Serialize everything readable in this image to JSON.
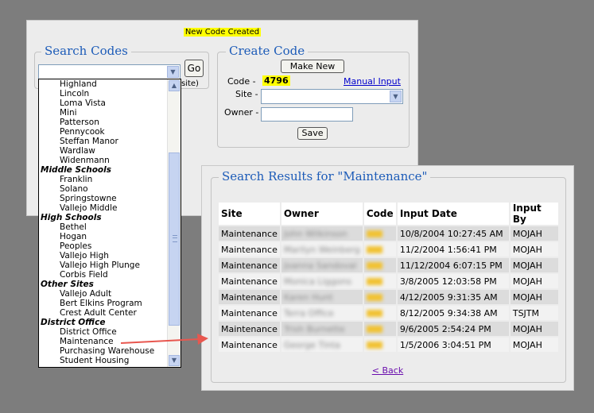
{
  "banner": {
    "message": "New Code Created"
  },
  "search_codes": {
    "legend": "Search Codes",
    "go_label": "Go",
    "hint_tail": "site)",
    "dropdown_items": [
      {
        "label": "Highland",
        "group": false
      },
      {
        "label": "Lincoln",
        "group": false
      },
      {
        "label": "Loma Vista",
        "group": false
      },
      {
        "label": "Mini",
        "group": false
      },
      {
        "label": "Patterson",
        "group": false
      },
      {
        "label": "Pennycook",
        "group": false
      },
      {
        "label": "Steffan Manor",
        "group": false
      },
      {
        "label": "Wardlaw",
        "group": false
      },
      {
        "label": "Widenmann",
        "group": false
      },
      {
        "label": "Middle Schools",
        "group": true
      },
      {
        "label": "Franklin",
        "group": false
      },
      {
        "label": "Solano",
        "group": false
      },
      {
        "label": "Springstowne",
        "group": false
      },
      {
        "label": "Vallejo Middle",
        "group": false
      },
      {
        "label": "High Schools",
        "group": true
      },
      {
        "label": "Bethel",
        "group": false
      },
      {
        "label": "Hogan",
        "group": false
      },
      {
        "label": "Peoples",
        "group": false
      },
      {
        "label": "Vallejo High",
        "group": false
      },
      {
        "label": "Vallejo High Plunge",
        "group": false
      },
      {
        "label": "Corbis Field",
        "group": false
      },
      {
        "label": "Other Sites",
        "group": true
      },
      {
        "label": "Vallejo Adult",
        "group": false
      },
      {
        "label": "Bert Elkins Program",
        "group": false
      },
      {
        "label": "Crest Adult Center",
        "group": false
      },
      {
        "label": "District Office",
        "group": true
      },
      {
        "label": "District Office",
        "group": false
      },
      {
        "label": "Maintenance",
        "group": false
      },
      {
        "label": "Purchasing Warehouse",
        "group": false
      },
      {
        "label": "Student Housing",
        "group": false
      }
    ]
  },
  "create_code": {
    "legend": "Create Code",
    "make_new_label": "Make New",
    "code_label": "Code -",
    "code_value": "4796",
    "manual_input_label": "Manual Input",
    "site_label": "Site -",
    "owner_label": "Owner -",
    "save_label": "Save"
  },
  "results": {
    "legend": "Search Results for \"Maintenance\"",
    "columns": [
      "Site",
      "Owner",
      "Code",
      "Input Date",
      "Input By"
    ],
    "rows": [
      {
        "site": "Maintenance",
        "owner": "John Wilkinson",
        "date": "10/8/2004 10:27:45 AM",
        "by": "MOJAH"
      },
      {
        "site": "Maintenance",
        "owner": "Marilyn Weinberg",
        "date": "11/2/2004 1:56:41 PM",
        "by": "MOJAH"
      },
      {
        "site": "Maintenance",
        "owner": "Joanna Sandoval",
        "date": "11/12/2004 6:07:15 PM",
        "by": "MOJAH"
      },
      {
        "site": "Maintenance",
        "owner": "Monica Liggons",
        "date": "3/8/2005 12:03:58 PM",
        "by": "MOJAH"
      },
      {
        "site": "Maintenance",
        "owner": "Karen Hunt",
        "date": "4/12/2005 9:31:35 AM",
        "by": "MOJAH"
      },
      {
        "site": "Maintenance",
        "owner": "Terra Office",
        "date": "8/12/2005 9:34:38 AM",
        "by": "TSJTM"
      },
      {
        "site": "Maintenance",
        "owner": "Trish Burnette",
        "date": "9/6/2005 2:54:24 PM",
        "by": "MOJAH"
      },
      {
        "site": "Maintenance",
        "owner": "George Tinta",
        "date": "1/5/2006 3:04:51 PM",
        "by": "MOJAH"
      }
    ],
    "back_label": "< Back"
  },
  "colors": {
    "legend_blue": "#1c5bb8",
    "highlight_yellow": "#ffff00",
    "arrow_red": "#e8574f"
  }
}
